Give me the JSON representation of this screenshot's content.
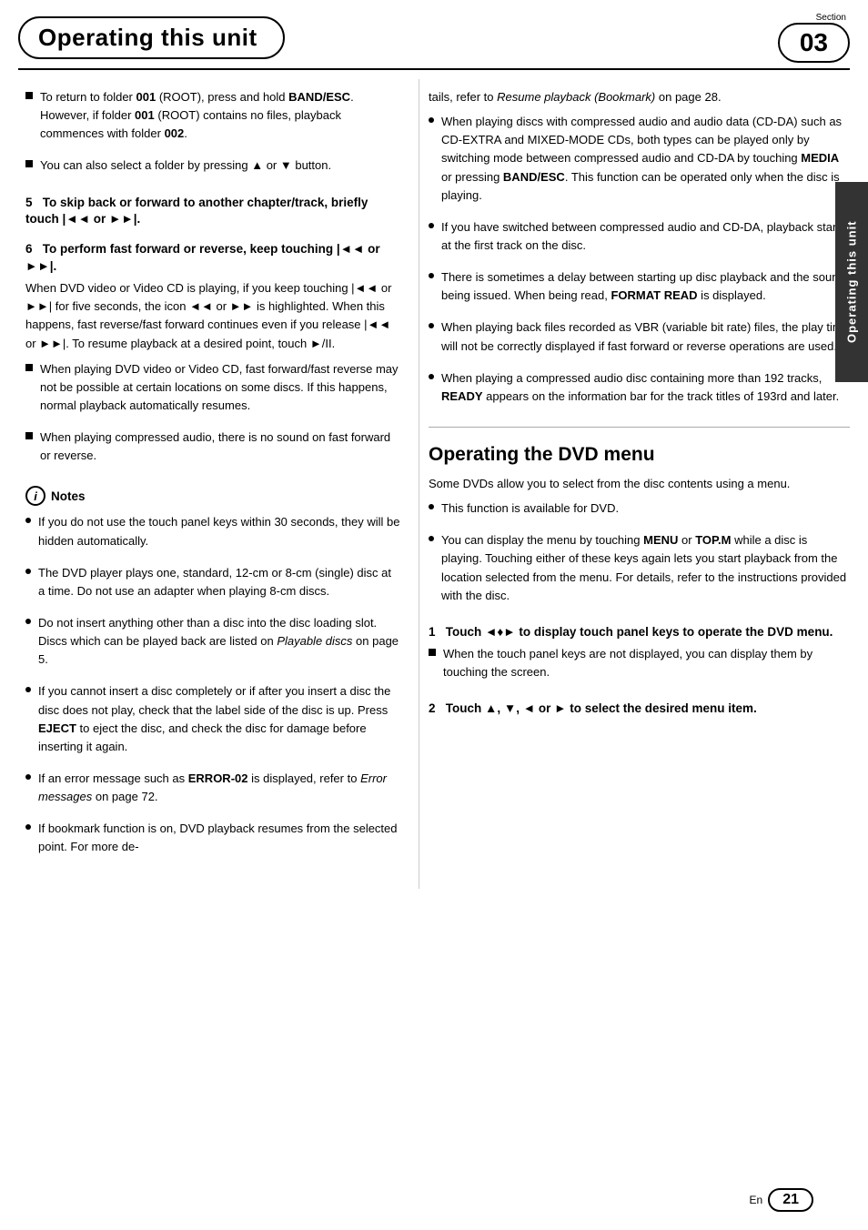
{
  "header": {
    "title": "Operating this unit",
    "section_label": "Section",
    "section_number": "03"
  },
  "side_tab": "Operating this unit",
  "left_col": {
    "intro_bullets": [
      {
        "type": "square",
        "text": "To return to folder 001 (ROOT), press and hold BAND/ESC. However, if folder 001 (ROOT) contains no files, playback commences with folder 002."
      },
      {
        "type": "square",
        "text": "You can also select a folder by pressing ▲ or ▼ button."
      }
    ],
    "step5": {
      "heading": "5 To skip back or forward to another chapter/track, briefly touch |◄◄ or ►►|.",
      "body": ""
    },
    "step6": {
      "heading": "6 To perform fast forward or reverse, keep touching |◄◄ or ►►|.",
      "body": "When DVD video or Video CD is playing, if you keep touching |◄◄ or ►►| for five seconds, the icon ◄◄ or ►► is highlighted. When this happens, fast reverse/fast forward continues even if you release |◄◄ or ►►|. To resume playback at a desired point, touch ►/II."
    },
    "step6_bullets": [
      {
        "type": "square",
        "text": "When playing DVD video or Video CD, fast forward/fast reverse may not be possible at certain locations on some discs. If this happens, normal playback automatically resumes."
      },
      {
        "type": "square",
        "text": "When playing compressed audio, there is no sound on fast forward or reverse."
      }
    ],
    "notes_label": "Notes",
    "notes_bullets": [
      "If you do not use the touch panel keys within 30 seconds, they will be hidden automatically.",
      "The DVD player plays one, standard, 12-cm or 8-cm (single) disc at a time. Do not use an adapter when playing 8-cm discs.",
      "Do not insert anything other than a disc into the disc loading slot. Discs which can be played back are listed on Playable discs on page 5.",
      "If you cannot insert a disc completely or if after you insert a disc the disc does not play, check that the label side of the disc is up. Press EJECT to eject the disc, and check the disc for damage before inserting it again.",
      "If an error message such as ERROR-02 is displayed, refer to Error messages on page 72.",
      "If bookmark function is on, DVD playback resumes from the selected point. For more de-"
    ]
  },
  "right_col": {
    "continued_text": "tails, refer to Resume playback (Bookmark) on page 28.",
    "bullets": [
      "When playing discs with compressed audio and audio data (CD-DA) such as CD-EXTRA and MIXED-MODE CDs, both types can be played only by switching mode between compressed audio and CD-DA by touching MEDIA or pressing BAND/ESC. This function can be operated only when the disc is playing.",
      "If you have switched between compressed audio and CD-DA, playback starts at the first track on the disc.",
      "There is sometimes a delay between starting up disc playback and the sound being issued. When being read, FORMAT READ is displayed.",
      "When playing back files recorded as VBR (variable bit rate) files, the play time will not be correctly displayed if fast forward or reverse operations are used.",
      "When playing a compressed audio disc containing more than 192 tracks,  READY appears on the information bar for the track titles of 193rd and later."
    ],
    "dvd_menu_heading": "Operating the DVD menu",
    "dvd_menu_intro": "Some DVDs allow you to select from the disc contents using a menu.",
    "dvd_menu_bullets": [
      "This function is available for DVD.",
      "You can display the menu by touching MENU or TOP.M while a disc is playing. Touching either of these keys again lets you start playback from the location selected from the menu. For details, refer to the instructions provided with the disc."
    ],
    "step1": {
      "heading": "1 Touch ◄♦► to display touch panel keys to operate the DVD menu.",
      "body": "When the touch panel keys are not displayed, you can display them by touching the screen."
    },
    "step1_bullet": "When the touch panel keys are not displayed, you can display them by touching the screen.",
    "step2": {
      "heading": "2 Touch ▲, ▼, ◄ or ► to select the desired menu item.",
      "body": ""
    }
  },
  "footer": {
    "en_label": "En",
    "page_number": "21"
  }
}
